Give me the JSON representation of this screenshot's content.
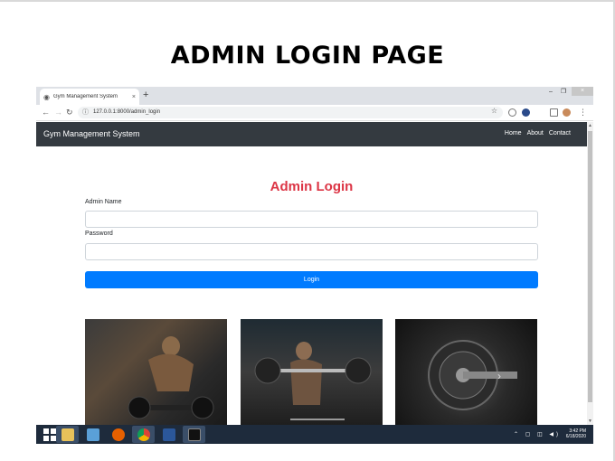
{
  "slide": {
    "title": "ADMIN LOGIN PAGE"
  },
  "browser": {
    "tab_title": "Gym Management System",
    "tab_close": "×",
    "new_tab": "+",
    "url": "127.0.0.1:8000/admin_login",
    "win_minimize": "–",
    "win_restore": "❐",
    "win_close": "×"
  },
  "navbar": {
    "brand": "Gym Management System",
    "links": [
      "Home",
      "About",
      "Contact"
    ]
  },
  "login": {
    "heading": "Admin Login",
    "name_label": "Admin Name",
    "password_label": "Password",
    "button_label": "Login"
  },
  "carousel": {
    "next_label": "›"
  },
  "taskbar": {
    "time": "3:42 PM",
    "date": "6/18/2020",
    "tray_icons": "⌃ ▢ ◫ ◀)"
  },
  "colors": {
    "navbar": "#343a40",
    "heading": "#dc3545",
    "primary": "#007bff",
    "taskbar": "#1e2b3c"
  }
}
